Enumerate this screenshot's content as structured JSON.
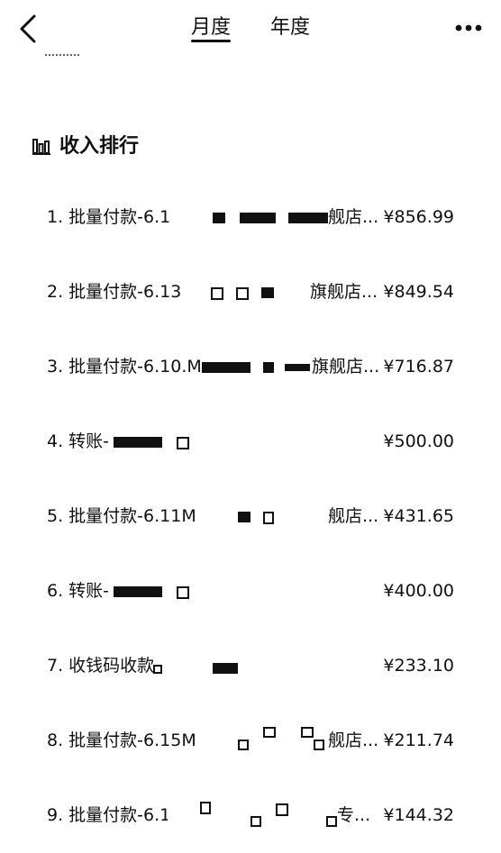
{
  "header": {
    "tabs": [
      {
        "label": "月度",
        "active": true
      },
      {
        "label": "年度",
        "active": false
      }
    ],
    "back_icon": "chevron-left-icon",
    "more_icon": "more-horizontal-icon"
  },
  "section": {
    "title": "收入排行",
    "icon": "bar-chart-icon"
  },
  "ranking": [
    {
      "label": "1. 批量付款-6.1",
      "suffix": "舰店...",
      "amount": "¥856.99"
    },
    {
      "label": "2. 批量付款-6.13",
      "suffix": "旗舰店...",
      "amount": "¥849.54"
    },
    {
      "label": "3. 批量付款-6.10.M",
      "suffix": "旗舰店...",
      "amount": "¥716.87"
    },
    {
      "label": "4. 转账-",
      "suffix": "",
      "amount": "¥500.00"
    },
    {
      "label": "5. 批量付款-6.11M",
      "suffix": "舰店...",
      "amount": "¥431.65"
    },
    {
      "label": "6. 转账-",
      "suffix": "",
      "amount": "¥400.00"
    },
    {
      "label": "7. 收钱码收款",
      "suffix": "",
      "amount": "¥233.10"
    },
    {
      "label": "8. 批量付款-6.15M",
      "suffix": "舰店...",
      "amount": "¥211.74"
    },
    {
      "label": "9. 批量付款-6.1",
      "suffix": "专...",
      "amount": "¥144.32"
    }
  ]
}
